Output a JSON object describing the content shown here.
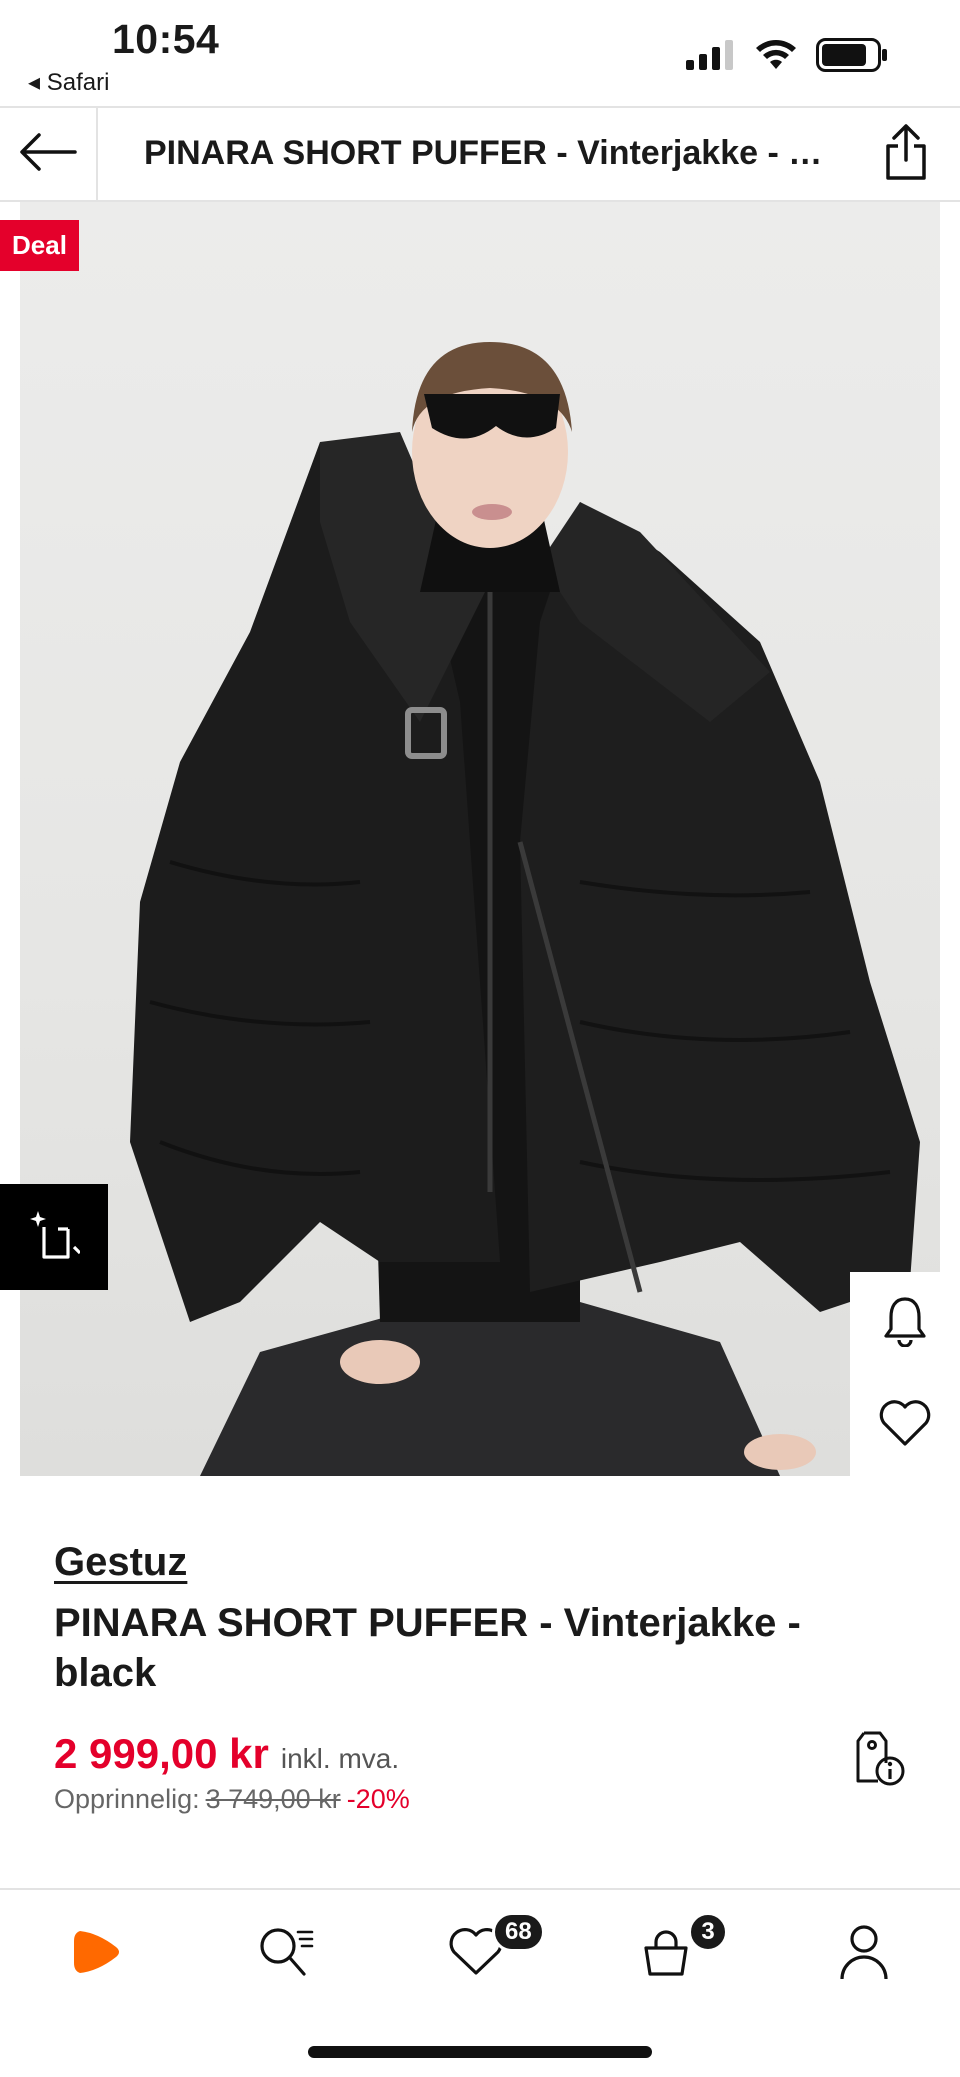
{
  "status_bar": {
    "time": "10:54",
    "back_app": "◂ Safari"
  },
  "header": {
    "title": "PINARA SHORT PUFFER - Vinterjakke - black",
    "back_icon": "arrow-left-icon",
    "share_icon": "share-icon"
  },
  "image": {
    "deal_label": "Deal",
    "side_icons": [
      "bell-icon",
      "heart-icon"
    ],
    "compare_icon": "compare-icon"
  },
  "product": {
    "brand": "Gestuz",
    "name": "PINARA SHORT PUFFER - Vinterjakke - black",
    "price": "2 999,00 kr",
    "vat_note": "inkl. mva.",
    "original_label": "Opprinnelig:",
    "original_price": "3 749,00 kr",
    "discount": "-20%"
  },
  "bottom_nav": {
    "items": [
      {
        "name": "home",
        "icon": "zalando-logo-icon"
      },
      {
        "name": "search",
        "icon": "search-icon"
      },
      {
        "name": "wishlist",
        "icon": "heart-icon",
        "badge": "68"
      },
      {
        "name": "bag",
        "icon": "bag-icon",
        "badge": "3"
      },
      {
        "name": "profile",
        "icon": "user-icon"
      }
    ]
  },
  "colors": {
    "accent_red": "#e4002b",
    "brand_orange": "#ff6900",
    "text": "#1a1a1a"
  }
}
